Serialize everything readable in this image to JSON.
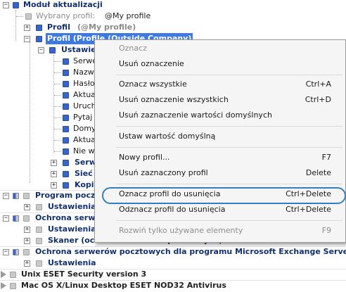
{
  "tree": {
    "modul": "Moduł aktualizacji",
    "wybrany_label": "Wybrany profil:",
    "wybrany_value": "@My profile",
    "profil_my_a": "Profil",
    "profil_my_b": "(@My profile)",
    "profil_sel": "Profil (Profile (Outside Company)",
    "ustawienia": "Ustawie",
    "items": [
      "Serwe",
      "Nazw",
      "Hasło",
      "Aktua",
      "Uruch",
      "Pytaj",
      "Domy",
      "Aktua",
      "Nie w"
    ],
    "serw": "Serw",
    "siec": "Sieć",
    "kopia": "Kopia",
    "program_pocz": "Program poczt",
    "ustawienia2": "Ustawienia",
    "ochrona_serw": "Ochrona serwer",
    "ustawienia3": "Ustawienia",
    "skaner": "Skaner (ochrona serwerów pocztowych)",
    "ochrona_exchange": "Ochrona serwerów pocztowych dla programu Microsoft Exchange Server",
    "ustawienia4": "Ustawienia",
    "unix": "Unix ESET Security version 3",
    "mac": "Mac OS X/Linux Desktop ESET NOD32 Antivirus"
  },
  "menu": {
    "oznacz": "Oznacz",
    "usun_oznaczenie": "Usuń oznaczenie",
    "oznacz_wszystkie": "Oznacz wszystkie",
    "oznacz_wszystkie_key": "Ctrl+A",
    "usun_wszystkich": "Usuń oznaczenie wszystkich",
    "usun_wszystkich_key": "Ctrl+D",
    "usun_domyslnych": "Usuń zaznaczenie wartości domyślnych",
    "ustaw_domyslna": "Ustaw wartość domyślną",
    "nowy_profil": "Nowy profil...",
    "nowy_profil_key": "F7",
    "usun_profil": "Usuń zaznaczony profil",
    "usun_profil_key": "Delete",
    "oznacz_usuniecie": "Oznacz profil do usunięcia",
    "oznacz_usuniecie_key": "Ctrl+Delete",
    "odznacz_usuniecie": "Odznacz profil do usunięcia",
    "odznacz_usuniecie_key": "Ctrl+Delete",
    "rozwin": "Rozwiń tylko używane elementy",
    "rozwin_key": "F9"
  },
  "colors": {
    "selection": "#3d7be0",
    "highlight_ring": "#2f7fc2",
    "node_blue": "#3766c8",
    "node_gray": "#c9c9c9"
  }
}
